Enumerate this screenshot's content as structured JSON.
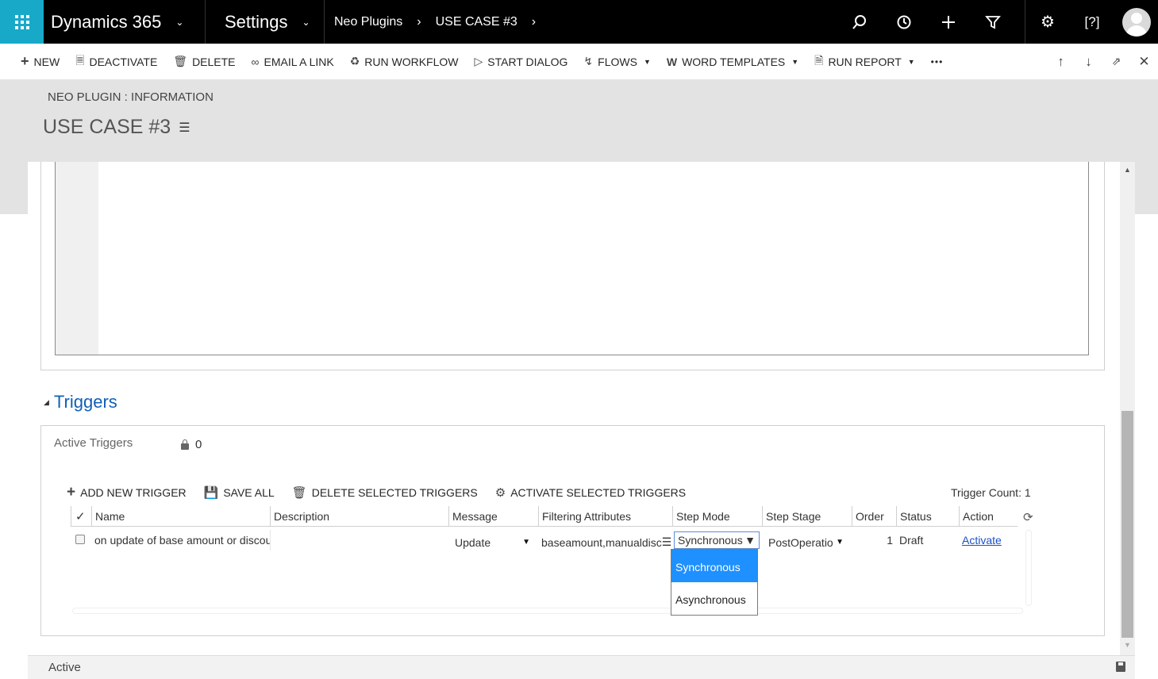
{
  "topnav": {
    "app_name": "Dynamics 365",
    "area": "Settings",
    "breadcrumb": [
      "Neo Plugins",
      "USE CASE #3"
    ]
  },
  "commandbar": {
    "new": "NEW",
    "deactivate": "DEACTIVATE",
    "delete": "DELETE",
    "email_link": "EMAIL A LINK",
    "run_workflow": "RUN WORKFLOW",
    "start_dialog": "START DIALOG",
    "flows": "FLOWS",
    "word_templates": "WORD TEMPLATES",
    "run_report": "RUN REPORT",
    "more": "•••"
  },
  "header": {
    "entity": "NEO PLUGIN : INFORMATION",
    "title": "USE CASE #3"
  },
  "triggers": {
    "section_title": "Triggers",
    "active_label": "Active Triggers",
    "active_value": "0",
    "toolbar": {
      "add": "ADD NEW TRIGGER",
      "save_all": "SAVE ALL",
      "delete_selected": "DELETE SELECTED TRIGGERS",
      "activate_selected": "ACTIVATE SELECTED TRIGGERS"
    },
    "trigger_count": "Trigger Count: 1",
    "columns": [
      "Name",
      "Description",
      "Message",
      "Filtering Attributes",
      "Step Mode",
      "Step Stage",
      "Order",
      "Status",
      "Action"
    ],
    "row": {
      "name": "on update of base amount or discou",
      "description": "",
      "message": "Update",
      "filtering_attributes": "baseamount,manualdisc",
      "step_mode": "Synchronous",
      "step_stage": "PostOperatio",
      "order": "1",
      "status": "Draft",
      "action": "Activate"
    },
    "step_mode_options": [
      "Synchronous",
      "Asynchronous"
    ]
  },
  "footer": {
    "status": "Active"
  },
  "colors": {
    "waffle": "#18a9c9",
    "nav_bg": "#000000",
    "accent_link": "#1160b7",
    "dropdown_highlight": "#1e90ff"
  }
}
